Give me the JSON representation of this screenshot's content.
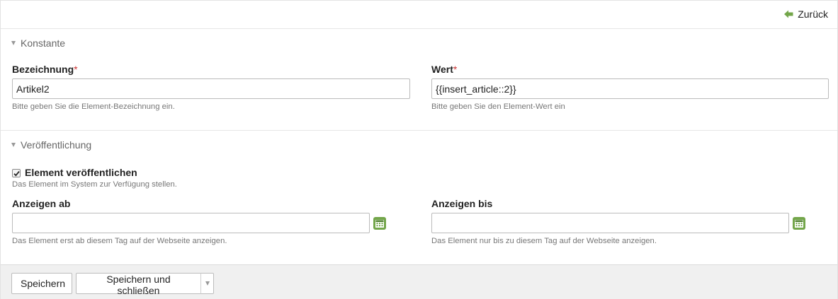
{
  "header": {
    "back_label": "Zurück"
  },
  "section_constant": {
    "title": "Konstante",
    "name_field": {
      "label": "Bezeichnung",
      "required_mark": "*",
      "value": "Artikel2",
      "help": "Bitte geben Sie die Element-Bezeichnung ein."
    },
    "value_field": {
      "label": "Wert",
      "required_mark": "*",
      "value": "{{insert_article::2}}",
      "help": "Bitte geben Sie den Element-Wert ein"
    }
  },
  "section_publish": {
    "title": "Veröffentlichung",
    "publish_checkbox": {
      "label": "Element veröffentlichen",
      "checked": true,
      "help": "Das Element im System zur Verfügung stellen."
    },
    "start_field": {
      "label": "Anzeigen ab",
      "value": "",
      "help": "Das Element erst ab diesem Tag auf der Webseite anzeigen.",
      "icon": "calendar-icon"
    },
    "stop_field": {
      "label": "Anzeigen bis",
      "value": "",
      "help": "Das Element nur bis zu diesem Tag auf der Webseite anzeigen.",
      "icon": "calendar-icon"
    }
  },
  "footer": {
    "save_label": "Speichern",
    "save_close_label": "Speichern und schließen",
    "split_icon": "chevron-down-icon"
  },
  "colors": {
    "accent_green": "#73a64a",
    "required_red": "#cc3333"
  }
}
